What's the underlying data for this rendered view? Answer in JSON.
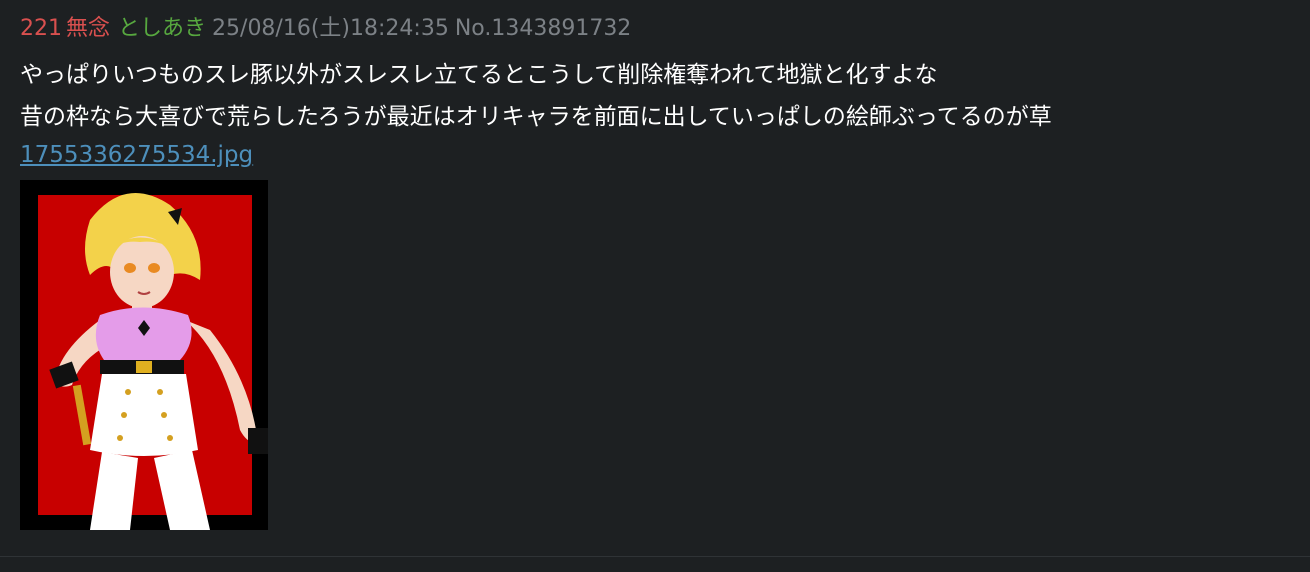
{
  "post": {
    "number": "221",
    "name": "無念",
    "trip": "としあき",
    "date": "25/08/16(土)18:24:35",
    "id": "No.1343891732",
    "lines": [
      "やっぱりいつものスレ豚以外がスレスレ立てるとこうして削除権奪われて地獄と化すよな",
      "昔の枠なら大喜びで荒らしたろうが最近はオリキャラを前面に出していっぱしの絵師ぶってるのが草"
    ],
    "attachment": {
      "filename": "1755336275534.jpg"
    }
  },
  "colors": {
    "background": "#1d2022",
    "number": "#d9504f",
    "name": "#d9504f",
    "trip": "#57a83f",
    "meta": "#7c8186",
    "link": "#4d8fbb",
    "text": "#ffffff"
  }
}
